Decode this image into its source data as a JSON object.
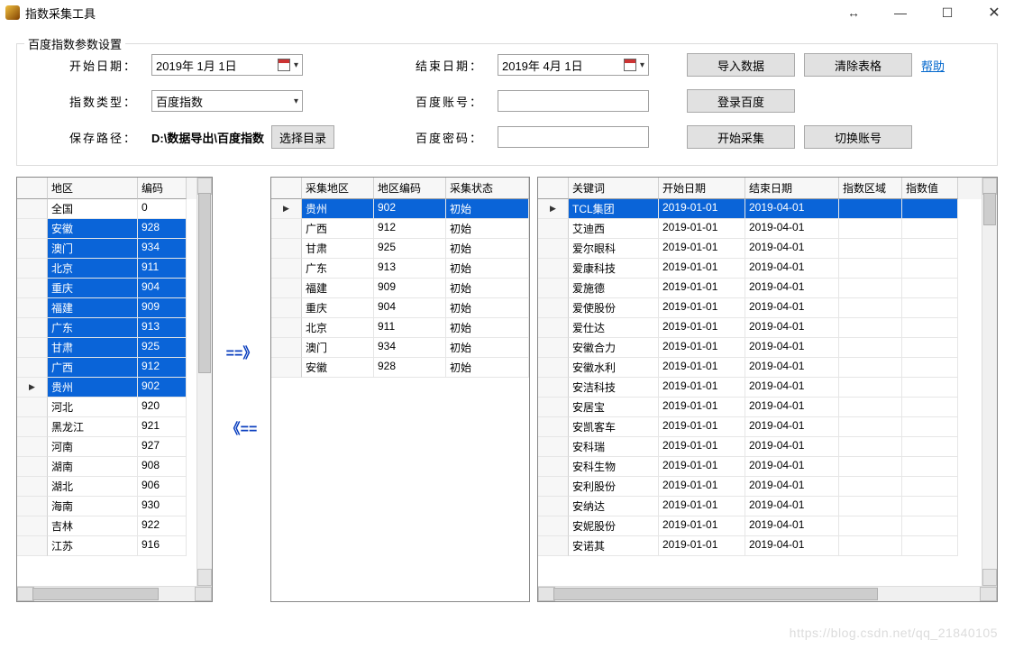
{
  "title": "指数采集工具",
  "settings": {
    "legend": "百度指数参数设置",
    "start_date_label": "开始日期：",
    "start_date_value": "2019年 1月 1日",
    "end_date_label": "结束日期：",
    "end_date_value": "2019年 4月 1日",
    "import_btn": "导入数据",
    "clear_btn": "清除表格",
    "help_link": "帮助",
    "index_type_label": "指数类型：",
    "index_type_value": "百度指数",
    "baidu_account_label": "百度账号：",
    "login_btn": "登录百度",
    "save_path_label": "保存路径：",
    "save_path_value": "D:\\数据导出\\百度指数",
    "choose_dir_btn": "选择目录",
    "baidu_pwd_label": "百度密码：",
    "start_collect_btn": "开始采集",
    "switch_account_btn": "切换账号"
  },
  "transfer": {
    "right": "==》",
    "left": "《=="
  },
  "panel1": {
    "headers": [
      "",
      "地区",
      "编码"
    ],
    "rows": [
      {
        "region": "全国",
        "code": "0",
        "sel": false,
        "cursor": false
      },
      {
        "region": "安徽",
        "code": "928",
        "sel": true,
        "cursor": false
      },
      {
        "region": "澳门",
        "code": "934",
        "sel": true,
        "cursor": false
      },
      {
        "region": "北京",
        "code": "911",
        "sel": true,
        "cursor": false
      },
      {
        "region": "重庆",
        "code": "904",
        "sel": true,
        "cursor": false
      },
      {
        "region": "福建",
        "code": "909",
        "sel": true,
        "cursor": false
      },
      {
        "region": "广东",
        "code": "913",
        "sel": true,
        "cursor": false
      },
      {
        "region": "甘肃",
        "code": "925",
        "sel": true,
        "cursor": false
      },
      {
        "region": "广西",
        "code": "912",
        "sel": true,
        "cursor": false
      },
      {
        "region": "贵州",
        "code": "902",
        "sel": true,
        "cursor": true
      },
      {
        "region": "河北",
        "code": "920",
        "sel": false,
        "cursor": false
      },
      {
        "region": "黑龙江",
        "code": "921",
        "sel": false,
        "cursor": false
      },
      {
        "region": "河南",
        "code": "927",
        "sel": false,
        "cursor": false
      },
      {
        "region": "湖南",
        "code": "908",
        "sel": false,
        "cursor": false
      },
      {
        "region": "湖北",
        "code": "906",
        "sel": false,
        "cursor": false
      },
      {
        "region": "海南",
        "code": "930",
        "sel": false,
        "cursor": false
      },
      {
        "region": "吉林",
        "code": "922",
        "sel": false,
        "cursor": false
      },
      {
        "region": "江苏",
        "code": "916",
        "sel": false,
        "cursor": false
      }
    ]
  },
  "panel2": {
    "headers": [
      "",
      "采集地区",
      "地区编码",
      "采集状态"
    ],
    "rows": [
      {
        "region": "贵州",
        "code": "902",
        "status": "初始",
        "sel": true,
        "cursor": true
      },
      {
        "region": "广西",
        "code": "912",
        "status": "初始",
        "sel": false,
        "cursor": false
      },
      {
        "region": "甘肃",
        "code": "925",
        "status": "初始",
        "sel": false,
        "cursor": false
      },
      {
        "region": "广东",
        "code": "913",
        "status": "初始",
        "sel": false,
        "cursor": false
      },
      {
        "region": "福建",
        "code": "909",
        "status": "初始",
        "sel": false,
        "cursor": false
      },
      {
        "region": "重庆",
        "code": "904",
        "status": "初始",
        "sel": false,
        "cursor": false
      },
      {
        "region": "北京",
        "code": "911",
        "status": "初始",
        "sel": false,
        "cursor": false
      },
      {
        "region": "澳门",
        "code": "934",
        "status": "初始",
        "sel": false,
        "cursor": false
      },
      {
        "region": "安徽",
        "code": "928",
        "status": "初始",
        "sel": false,
        "cursor": false
      }
    ]
  },
  "panel3": {
    "headers": [
      "",
      "关键词",
      "开始日期",
      "结束日期",
      "指数区域",
      "指数值"
    ],
    "rows": [
      {
        "kw": "TCL集团",
        "sd": "2019-01-01",
        "ed": "2019-04-01",
        "sel": true,
        "cursor": true
      },
      {
        "kw": "艾迪西",
        "sd": "2019-01-01",
        "ed": "2019-04-01",
        "sel": false,
        "cursor": false
      },
      {
        "kw": "爱尔眼科",
        "sd": "2019-01-01",
        "ed": "2019-04-01",
        "sel": false,
        "cursor": false
      },
      {
        "kw": "爱康科技",
        "sd": "2019-01-01",
        "ed": "2019-04-01",
        "sel": false,
        "cursor": false
      },
      {
        "kw": "爱施德",
        "sd": "2019-01-01",
        "ed": "2019-04-01",
        "sel": false,
        "cursor": false
      },
      {
        "kw": "爱使股份",
        "sd": "2019-01-01",
        "ed": "2019-04-01",
        "sel": false,
        "cursor": false
      },
      {
        "kw": "爱仕达",
        "sd": "2019-01-01",
        "ed": "2019-04-01",
        "sel": false,
        "cursor": false
      },
      {
        "kw": "安徽合力",
        "sd": "2019-01-01",
        "ed": "2019-04-01",
        "sel": false,
        "cursor": false
      },
      {
        "kw": "安徽水利",
        "sd": "2019-01-01",
        "ed": "2019-04-01",
        "sel": false,
        "cursor": false
      },
      {
        "kw": "安洁科技",
        "sd": "2019-01-01",
        "ed": "2019-04-01",
        "sel": false,
        "cursor": false
      },
      {
        "kw": "安居宝",
        "sd": "2019-01-01",
        "ed": "2019-04-01",
        "sel": false,
        "cursor": false
      },
      {
        "kw": "安凯客车",
        "sd": "2019-01-01",
        "ed": "2019-04-01",
        "sel": false,
        "cursor": false
      },
      {
        "kw": "安科瑞",
        "sd": "2019-01-01",
        "ed": "2019-04-01",
        "sel": false,
        "cursor": false
      },
      {
        "kw": "安科生物",
        "sd": "2019-01-01",
        "ed": "2019-04-01",
        "sel": false,
        "cursor": false
      },
      {
        "kw": "安利股份",
        "sd": "2019-01-01",
        "ed": "2019-04-01",
        "sel": false,
        "cursor": false
      },
      {
        "kw": "安纳达",
        "sd": "2019-01-01",
        "ed": "2019-04-01",
        "sel": false,
        "cursor": false
      },
      {
        "kw": "安妮股份",
        "sd": "2019-01-01",
        "ed": "2019-04-01",
        "sel": false,
        "cursor": false
      },
      {
        "kw": "安诺其",
        "sd": "2019-01-01",
        "ed": "2019-04-01",
        "sel": false,
        "cursor": false
      }
    ]
  },
  "watermark": "https://blog.csdn.net/qq_21840105"
}
